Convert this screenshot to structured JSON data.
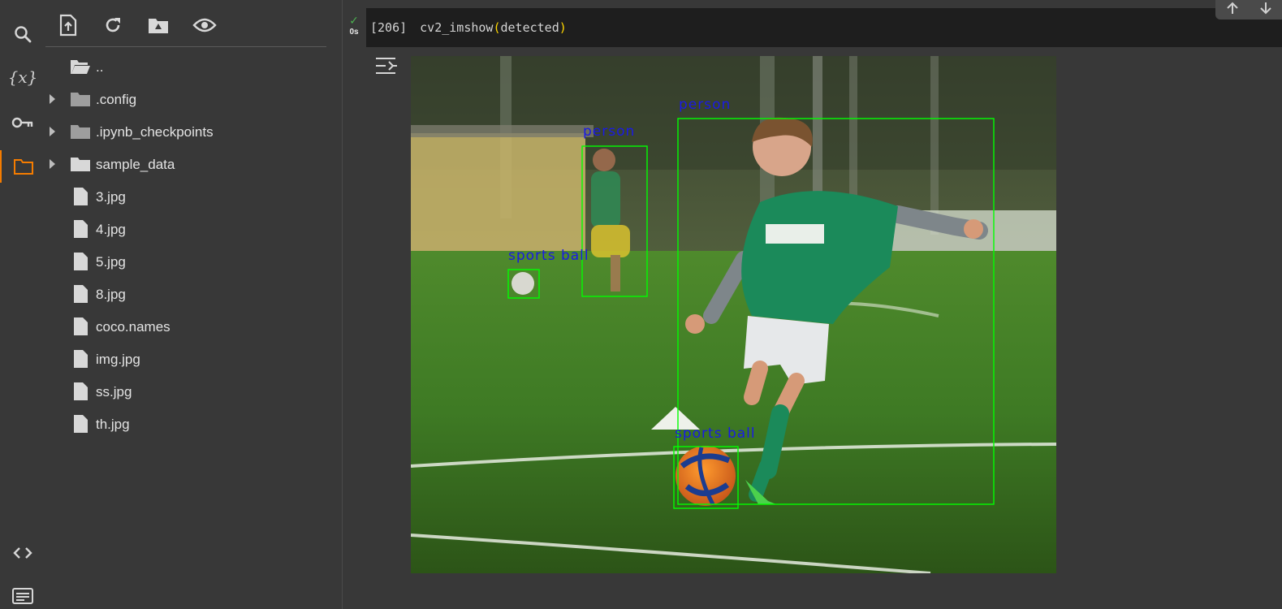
{
  "rail": {
    "items": [
      {
        "name": "search",
        "icon": "search-icon"
      },
      {
        "name": "variables",
        "icon": "variables-icon",
        "glyph": "{x}"
      },
      {
        "name": "secrets",
        "icon": "key-icon"
      },
      {
        "name": "files",
        "icon": "folder-icon",
        "active": true
      },
      {
        "name": "code-snippets",
        "icon": "code-icon"
      },
      {
        "name": "terminal",
        "icon": "terminal-icon"
      }
    ],
    "variables_glyph": "{x}"
  },
  "file_toolbar": {
    "buttons": [
      "upload-file-icon",
      "refresh-icon",
      "mount-drive-icon",
      "show-hidden-icon"
    ]
  },
  "file_tree": [
    {
      "label": "..",
      "type": "parent"
    },
    {
      "label": ".config",
      "type": "folder"
    },
    {
      "label": ".ipynb_checkpoints",
      "type": "folder"
    },
    {
      "label": "sample_data",
      "type": "folder"
    },
    {
      "label": "3.jpg",
      "type": "file"
    },
    {
      "label": "4.jpg",
      "type": "file"
    },
    {
      "label": "5.jpg",
      "type": "file"
    },
    {
      "label": "8.jpg",
      "type": "file"
    },
    {
      "label": "coco.names",
      "type": "file"
    },
    {
      "label": "img.jpg",
      "type": "file"
    },
    {
      "label": "ss.jpg",
      "type": "file"
    },
    {
      "label": "th.jpg",
      "type": "file"
    }
  ],
  "cell": {
    "status_icon": "check-icon",
    "run_time": "0s",
    "exec_count": "[206]",
    "code_fn": "cv2_imshow",
    "code_open": "(",
    "code_arg": "detected",
    "code_close": ")"
  },
  "output": {
    "icon": "output-settings-icon",
    "detections": [
      {
        "label": "person"
      },
      {
        "label": "person"
      },
      {
        "label": "sports ball"
      },
      {
        "label": "sports ball"
      }
    ],
    "box_color": "#00ff00",
    "label_color": "#1a1ae6"
  }
}
